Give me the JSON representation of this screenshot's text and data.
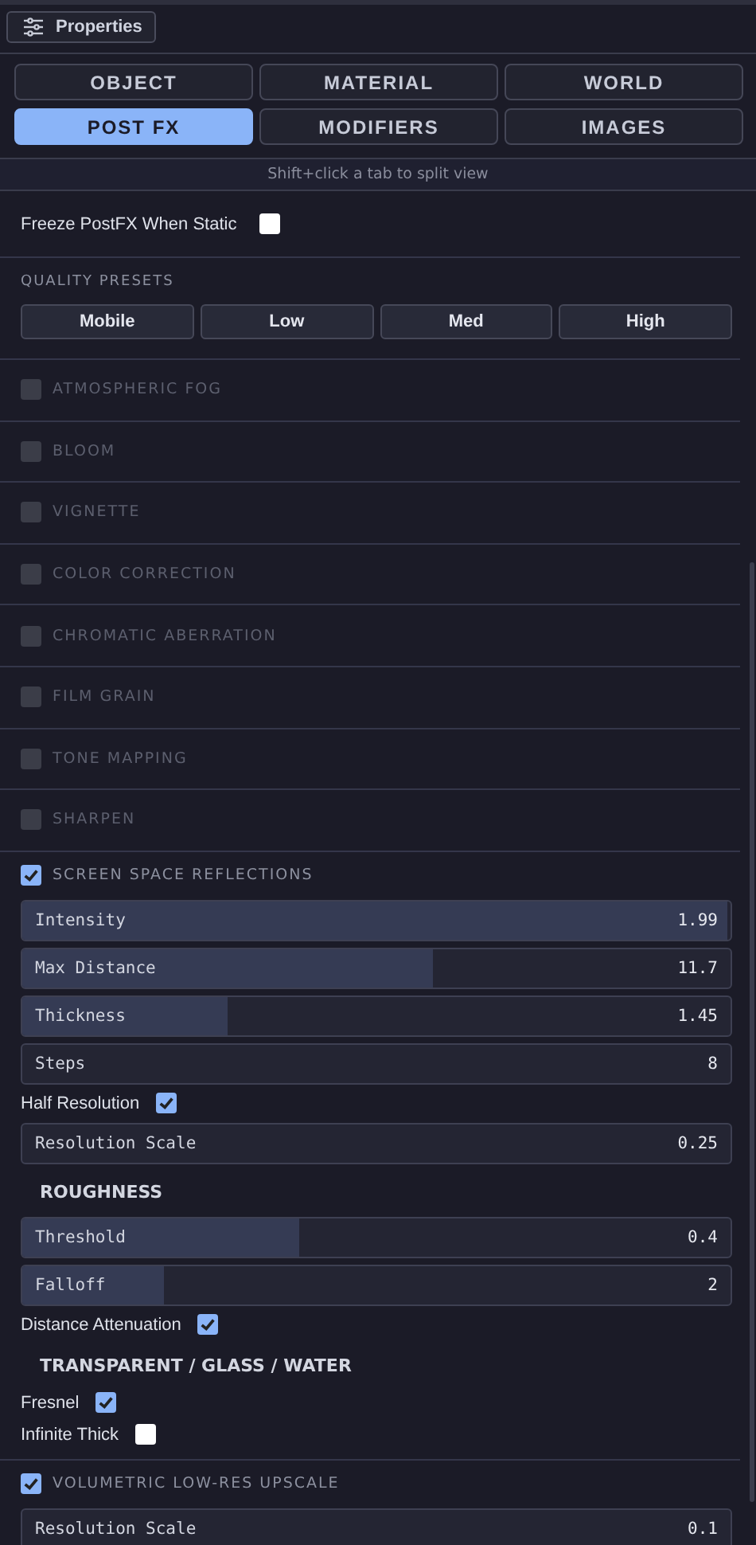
{
  "panel": {
    "title": "Properties"
  },
  "tabs": [
    {
      "label": "OBJECT",
      "selected": false
    },
    {
      "label": "MATERIAL",
      "selected": false
    },
    {
      "label": "WORLD",
      "selected": false
    },
    {
      "label": "POST FX",
      "selected": true
    },
    {
      "label": "MODIFIERS",
      "selected": false
    },
    {
      "label": "IMAGES",
      "selected": false
    }
  ],
  "hint": "Shift+click a tab to split view",
  "freeze": {
    "label": "Freeze PostFX When Static",
    "checked": false
  },
  "presets": {
    "title": "QUALITY PRESETS",
    "buttons": [
      "Mobile",
      "Low",
      "Med",
      "High"
    ]
  },
  "sections": [
    {
      "title": "ATMOSPHERIC FOG",
      "enabled": false
    },
    {
      "title": "BLOOM",
      "enabled": false
    },
    {
      "title": "VIGNETTE",
      "enabled": false
    },
    {
      "title": "COLOR CORRECTION",
      "enabled": false
    },
    {
      "title": "CHROMATIC ABERRATION",
      "enabled": false
    },
    {
      "title": "FILM GRAIN",
      "enabled": false
    },
    {
      "title": "TONE MAPPING",
      "enabled": false
    },
    {
      "title": "SHARPEN",
      "enabled": false
    },
    {
      "title": "SCREEN SPACE REFLECTIONS",
      "enabled": true,
      "items": [
        {
          "kind": "slider",
          "label": "Intensity",
          "value": "1.99",
          "level": 0.995
        },
        {
          "kind": "slider",
          "label": "Max Distance",
          "value": "11.7",
          "level": 0.58
        },
        {
          "kind": "slider",
          "label": "Thickness",
          "value": "1.45",
          "level": 0.29
        },
        {
          "kind": "slider",
          "label": "Steps",
          "value": "8"
        },
        {
          "kind": "checkbox",
          "label": "Half Resolution",
          "checked": true
        },
        {
          "kind": "slider",
          "label": "Resolution Scale",
          "value": "0.25"
        },
        {
          "kind": "heading",
          "label": "ROUGHNESS"
        },
        {
          "kind": "slider",
          "label": "Threshold",
          "value": "0.4",
          "level": 0.39
        },
        {
          "kind": "slider",
          "label": "Falloff",
          "value": "2",
          "level": 0.2
        },
        {
          "kind": "checkbox",
          "label": "Distance Attenuation",
          "checked": true
        },
        {
          "kind": "heading",
          "label": "TRANSPARENT / GLASS / WATER"
        },
        {
          "kind": "checkbox",
          "label": "Fresnel",
          "checked": true
        },
        {
          "kind": "checkbox",
          "label": "Infinite Thick",
          "checked": false
        }
      ]
    },
    {
      "title": "VOLUMETRIC LOW-RES UPSCALE",
      "enabled": true,
      "items": [
        {
          "kind": "slider",
          "label": "Resolution Scale",
          "value": "0.1"
        }
      ]
    }
  ]
}
